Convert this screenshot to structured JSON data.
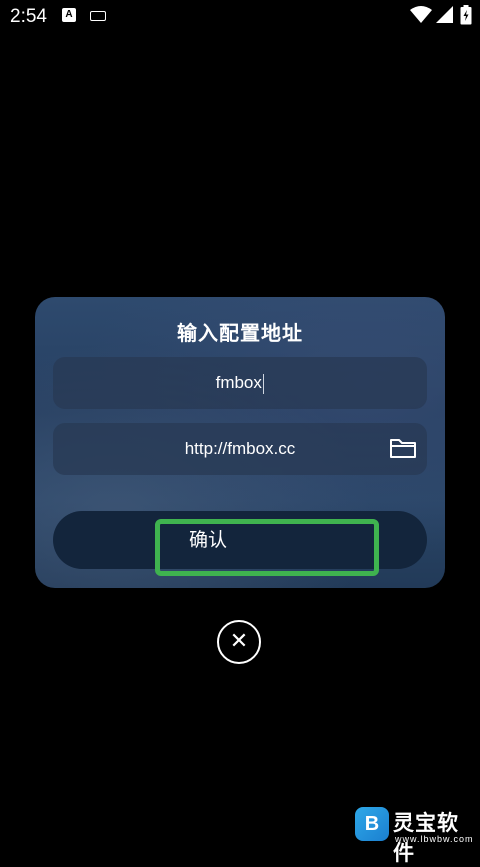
{
  "status_bar": {
    "time": "2:54",
    "icons": [
      "a-notification-icon",
      "keyboard-icon",
      "wifi-icon",
      "signal-icon",
      "battery-icon"
    ],
    "a_letter": "A"
  },
  "dialog": {
    "title": "输入配置地址",
    "name_field": {
      "value": "fmbox"
    },
    "url_field": {
      "value": "http://fmbox.cc"
    },
    "confirm_label": "确认"
  },
  "close_symbol": "✕",
  "watermark": {
    "logo_letter": "B",
    "title": "灵宝软件",
    "url": "www.lbwbw.com"
  },
  "colors": {
    "background": "#000000",
    "dialog": "#2a4668",
    "field": "#283a54",
    "confirm": "#13253c",
    "highlight": "#3fb34f"
  }
}
